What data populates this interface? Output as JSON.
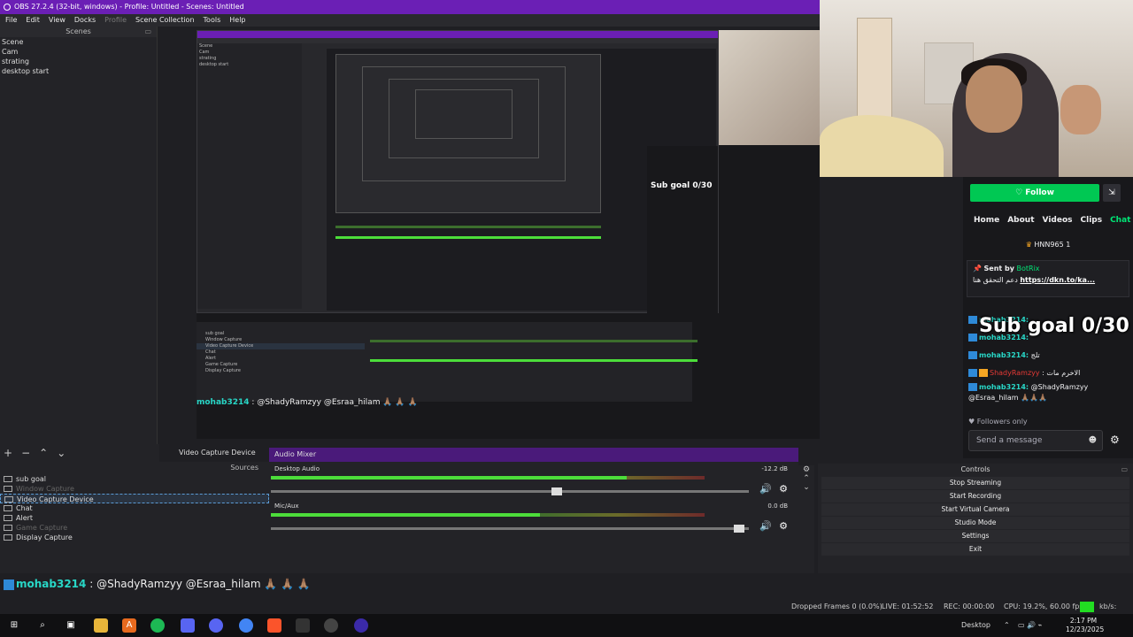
{
  "window": {
    "title": "OBS 27.2.4 (32-bit, windows) - Profile: Untitled - Scenes: Untitled"
  },
  "menu": {
    "file": "File",
    "edit": "Edit",
    "view": "View",
    "docks": "Docks",
    "profile": "Profile",
    "scene_collection": "Scene Collection",
    "tools": "Tools",
    "help": "Help"
  },
  "scenes": {
    "title": "Scenes",
    "items": [
      "Scene",
      "Cam",
      "strating",
      "desktop start"
    ]
  },
  "sources": {
    "title": "Sources",
    "current": "Video Capture Device",
    "items": [
      "sub goal",
      "Window Capture",
      "Video Capture Device",
      "Chat",
      "Alert",
      "Game Capture",
      "Display Capture"
    ]
  },
  "mixer": {
    "title": "Audio Mixer",
    "tracks": [
      {
        "name": "Desktop Audio",
        "db": "-12.2 dB",
        "level": 0.82,
        "volume": 0.61
      },
      {
        "name": "Mic/Aux",
        "db": "0.0 dB",
        "level": 0.62,
        "volume": 0.99
      }
    ]
  },
  "controls": {
    "title": "Controls",
    "buttons": [
      "Stop Streaming",
      "Start Recording",
      "Start Virtual Camera",
      "Studio Mode",
      "Settings",
      "Exit"
    ]
  },
  "chat": {
    "follow": "Follow",
    "tabs": [
      "Home",
      "About",
      "Videos",
      "Clips",
      "Chat"
    ],
    "viewer": "HNN965 1",
    "pinned_sentby": "Sent by",
    "pinned_sender": "BotRix",
    "pinned_msg": "دعم التحقق هنا",
    "pinned_link": "https://dkn.to/ka...",
    "subgoal": "Sub goal 0/30",
    "lines": [
      {
        "user": "mohab3214:",
        "text": ""
      },
      {
        "user": "mohab3214:",
        "text": ""
      },
      {
        "user": "mohab3214:",
        "text": "تلج"
      },
      {
        "user": "ShadyRamzyy",
        "text": ": الاخرم مات"
      },
      {
        "user": "mohab3214:",
        "text": "@ShadyRamzyy"
      }
    ],
    "line_tail": "@Esraa_hilam 🙏🏽🙏🏽🙏🏽",
    "followers_only": "Followers only",
    "send_placeholder": "Send a message"
  },
  "caption": {
    "user": "mohab3214",
    "text": ": @ShadyRamzyy @Esraa_hilam 🙏🏽 🙏🏽 🙏🏽"
  },
  "status": {
    "dropped": "Dropped Frames 0 (0.0%)",
    "live": "LIVE: 01:52:52",
    "rec": "REC: 00:00:00",
    "cpu": "CPU: 19.2%, 60.00 fps",
    "kbps": "kb/s: 3065"
  },
  "taskbar": {
    "desktop": "Desktop",
    "time": "2:17 PM",
    "date": "12/23/2025"
  },
  "colors": {
    "accent": "#6b1fb5",
    "follow": "#00c853",
    "live_green": "#22dd22"
  }
}
